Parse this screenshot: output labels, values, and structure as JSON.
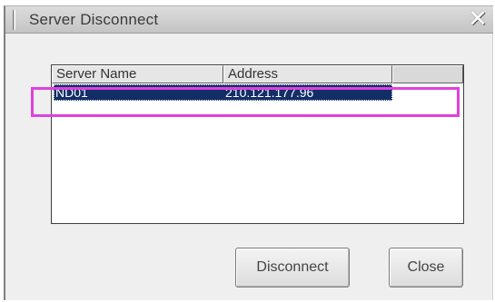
{
  "dialog": {
    "title": "Server Disconnect",
    "close_glyph": "✕",
    "close_icon": "close-icon"
  },
  "server_list": {
    "columns": [
      "Server Name",
      "Address"
    ],
    "rows": [
      {
        "name": "ND01",
        "address": "210.121.177.96",
        "selected": true
      }
    ]
  },
  "buttons": {
    "disconnect_label": "Disconnect",
    "close_label": "Close"
  },
  "colors": {
    "selection_bg": "#132e67",
    "annotation_highlight": "#e040e0"
  }
}
